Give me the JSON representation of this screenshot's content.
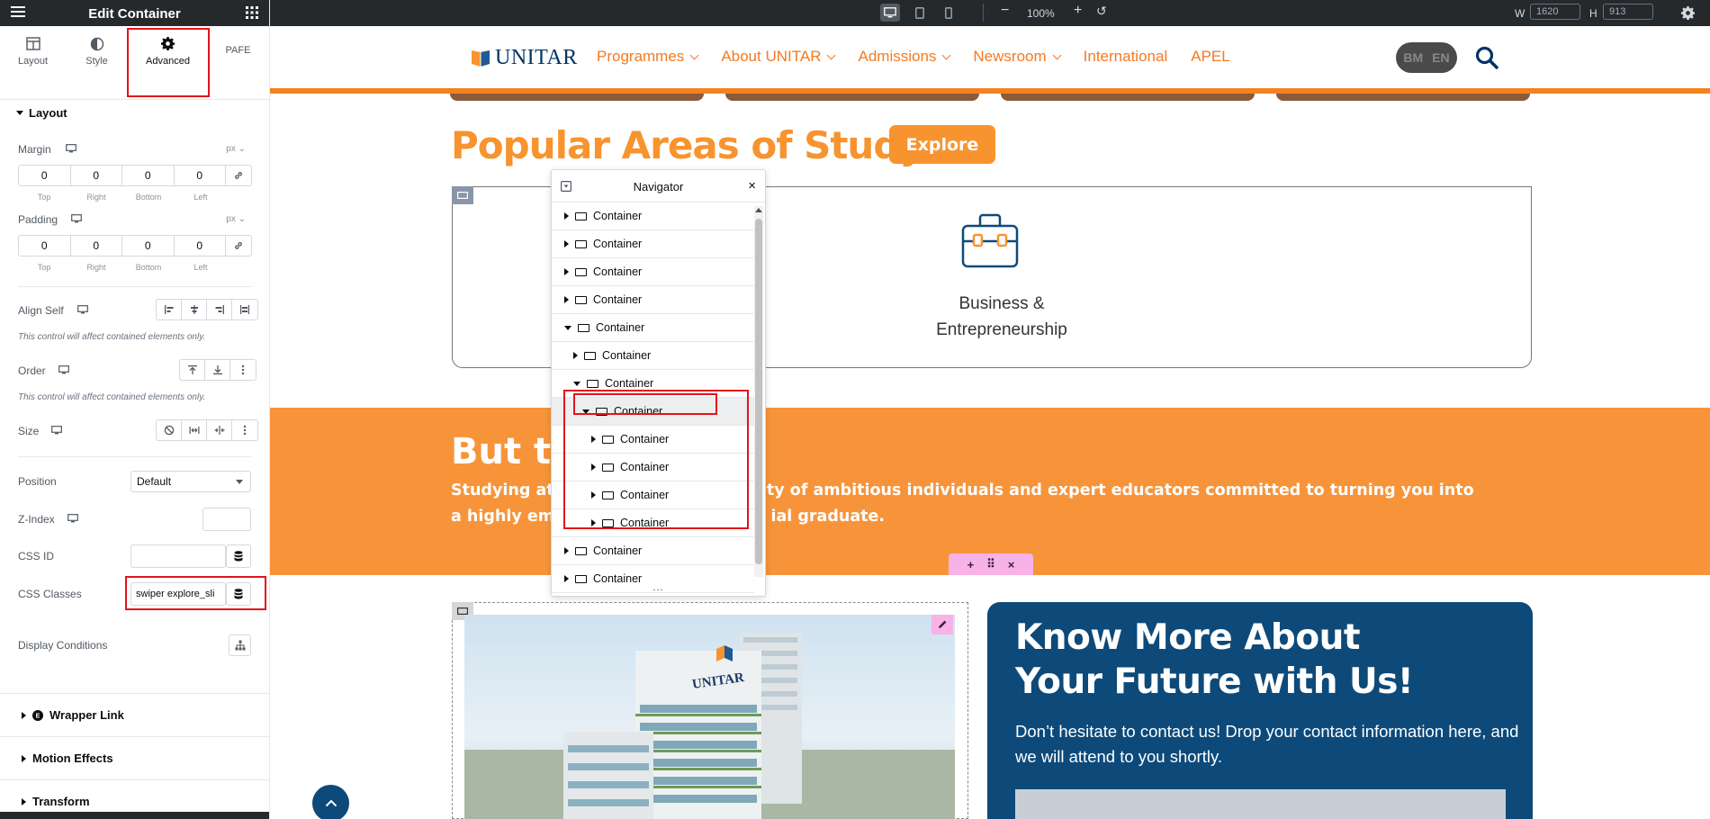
{
  "editor": {
    "panel_title": "Edit Container",
    "tabs": [
      {
        "label": "Layout",
        "icon": "layout-icon"
      },
      {
        "label": "Style",
        "icon": "style-icon"
      },
      {
        "label": "Advanced",
        "icon": "gear-icon",
        "active": true
      },
      {
        "label": "PAFE",
        "icon": ""
      }
    ],
    "layout_section": "Layout",
    "margin": {
      "label": "Margin",
      "unit": "px",
      "values": [
        "0",
        "0",
        "0",
        "0"
      ]
    },
    "padding": {
      "label": "Padding",
      "unit": "px",
      "values": [
        "0",
        "0",
        "0",
        "0"
      ]
    },
    "dim_labels": [
      "Top",
      "Right",
      "Bottom",
      "Left"
    ],
    "align_self": {
      "label": "Align Self",
      "note": "This control will affect contained elements only."
    },
    "order": {
      "label": "Order",
      "note": "This control will affect contained elements only."
    },
    "size": {
      "label": "Size"
    },
    "position": {
      "label": "Position",
      "value": "Default"
    },
    "z_index": {
      "label": "Z-Index",
      "value": ""
    },
    "css_id": {
      "label": "CSS ID",
      "value": ""
    },
    "css_classes": {
      "label": "CSS Classes",
      "value": "swiper explore_sli"
    },
    "display_conditions": "Display Conditions",
    "sections": [
      "Wrapper Link",
      "Motion Effects",
      "Transform"
    ]
  },
  "topbar": {
    "zoom": "100%",
    "width_label": "W",
    "width_value": "1620",
    "height_label": "H",
    "height_value": "913"
  },
  "site": {
    "logo": "UNITAR",
    "nav": [
      "Programmes",
      "About UNITAR",
      "Admissions",
      "Newsroom",
      "International",
      "APEL"
    ],
    "nav_has_dropdown": [
      true,
      true,
      true,
      true,
      false,
      false
    ],
    "lang": [
      "BM",
      "EN"
    ],
    "popular_title": "Popular Areas of Study",
    "explore_button": "Explore",
    "card_label_1": "Business &",
    "card_label_2": "Entrepreneurship",
    "band_heading": "But th",
    "band_text_1a": "Studying at",
    "band_text_1b": "g a community of ambitious individuals and expert educators committed to turning you into",
    "band_text_2a": "a highly emp",
    "band_text_2b": "ial graduate.",
    "know_title": "Know More About Your Future with Us!",
    "know_text": "Don’t hesitate to contact us! Drop your contact information here, and we will attend to you shortly.",
    "building_sign": "UNITAR",
    "accent_color": "#f7942f",
    "navy_color": "#0d4a7a"
  },
  "navigator": {
    "title": "Navigator",
    "rows": [
      {
        "label": "Container",
        "indent": 0,
        "state": "collapsed"
      },
      {
        "label": "Container",
        "indent": 0,
        "state": "collapsed"
      },
      {
        "label": "Container",
        "indent": 0,
        "state": "collapsed"
      },
      {
        "label": "Container",
        "indent": 0,
        "state": "collapsed"
      },
      {
        "label": "Container",
        "indent": 0,
        "state": "expanded"
      },
      {
        "label": "Container",
        "indent": 1,
        "state": "collapsed"
      },
      {
        "label": "Container",
        "indent": 1,
        "state": "expanded"
      },
      {
        "label": "Container",
        "indent": 2,
        "state": "expanded",
        "selected": true
      },
      {
        "label": "Container",
        "indent": 3,
        "state": "collapsed"
      },
      {
        "label": "Container",
        "indent": 3,
        "state": "collapsed"
      },
      {
        "label": "Container",
        "indent": 3,
        "state": "collapsed"
      },
      {
        "label": "Container",
        "indent": 3,
        "state": "collapsed"
      },
      {
        "label": "Container",
        "indent": 0,
        "state": "collapsed"
      },
      {
        "label": "Container",
        "indent": 0,
        "state": "collapsed"
      }
    ],
    "footer": "..."
  }
}
